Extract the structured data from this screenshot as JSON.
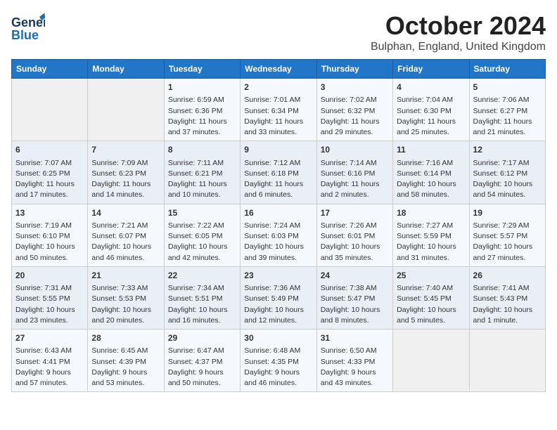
{
  "header": {
    "logo_general": "General",
    "logo_blue": "Blue",
    "month": "October 2024",
    "location": "Bulphan, England, United Kingdom"
  },
  "days_of_week": [
    "Sunday",
    "Monday",
    "Tuesday",
    "Wednesday",
    "Thursday",
    "Friday",
    "Saturday"
  ],
  "weeks": [
    [
      {
        "day": "",
        "data": ""
      },
      {
        "day": "",
        "data": ""
      },
      {
        "day": "1",
        "data": "Sunrise: 6:59 AM\nSunset: 6:36 PM\nDaylight: 11 hours and 37 minutes."
      },
      {
        "day": "2",
        "data": "Sunrise: 7:01 AM\nSunset: 6:34 PM\nDaylight: 11 hours and 33 minutes."
      },
      {
        "day": "3",
        "data": "Sunrise: 7:02 AM\nSunset: 6:32 PM\nDaylight: 11 hours and 29 minutes."
      },
      {
        "day": "4",
        "data": "Sunrise: 7:04 AM\nSunset: 6:30 PM\nDaylight: 11 hours and 25 minutes."
      },
      {
        "day": "5",
        "data": "Sunrise: 7:06 AM\nSunset: 6:27 PM\nDaylight: 11 hours and 21 minutes."
      }
    ],
    [
      {
        "day": "6",
        "data": "Sunrise: 7:07 AM\nSunset: 6:25 PM\nDaylight: 11 hours and 17 minutes."
      },
      {
        "day": "7",
        "data": "Sunrise: 7:09 AM\nSunset: 6:23 PM\nDaylight: 11 hours and 14 minutes."
      },
      {
        "day": "8",
        "data": "Sunrise: 7:11 AM\nSunset: 6:21 PM\nDaylight: 11 hours and 10 minutes."
      },
      {
        "day": "9",
        "data": "Sunrise: 7:12 AM\nSunset: 6:18 PM\nDaylight: 11 hours and 6 minutes."
      },
      {
        "day": "10",
        "data": "Sunrise: 7:14 AM\nSunset: 6:16 PM\nDaylight: 11 hours and 2 minutes."
      },
      {
        "day": "11",
        "data": "Sunrise: 7:16 AM\nSunset: 6:14 PM\nDaylight: 10 hours and 58 minutes."
      },
      {
        "day": "12",
        "data": "Sunrise: 7:17 AM\nSunset: 6:12 PM\nDaylight: 10 hours and 54 minutes."
      }
    ],
    [
      {
        "day": "13",
        "data": "Sunrise: 7:19 AM\nSunset: 6:10 PM\nDaylight: 10 hours and 50 minutes."
      },
      {
        "day": "14",
        "data": "Sunrise: 7:21 AM\nSunset: 6:07 PM\nDaylight: 10 hours and 46 minutes."
      },
      {
        "day": "15",
        "data": "Sunrise: 7:22 AM\nSunset: 6:05 PM\nDaylight: 10 hours and 42 minutes."
      },
      {
        "day": "16",
        "data": "Sunrise: 7:24 AM\nSunset: 6:03 PM\nDaylight: 10 hours and 39 minutes."
      },
      {
        "day": "17",
        "data": "Sunrise: 7:26 AM\nSunset: 6:01 PM\nDaylight: 10 hours and 35 minutes."
      },
      {
        "day": "18",
        "data": "Sunrise: 7:27 AM\nSunset: 5:59 PM\nDaylight: 10 hours and 31 minutes."
      },
      {
        "day": "19",
        "data": "Sunrise: 7:29 AM\nSunset: 5:57 PM\nDaylight: 10 hours and 27 minutes."
      }
    ],
    [
      {
        "day": "20",
        "data": "Sunrise: 7:31 AM\nSunset: 5:55 PM\nDaylight: 10 hours and 23 minutes."
      },
      {
        "day": "21",
        "data": "Sunrise: 7:33 AM\nSunset: 5:53 PM\nDaylight: 10 hours and 20 minutes."
      },
      {
        "day": "22",
        "data": "Sunrise: 7:34 AM\nSunset: 5:51 PM\nDaylight: 10 hours and 16 minutes."
      },
      {
        "day": "23",
        "data": "Sunrise: 7:36 AM\nSunset: 5:49 PM\nDaylight: 10 hours and 12 minutes."
      },
      {
        "day": "24",
        "data": "Sunrise: 7:38 AM\nSunset: 5:47 PM\nDaylight: 10 hours and 8 minutes."
      },
      {
        "day": "25",
        "data": "Sunrise: 7:40 AM\nSunset: 5:45 PM\nDaylight: 10 hours and 5 minutes."
      },
      {
        "day": "26",
        "data": "Sunrise: 7:41 AM\nSunset: 5:43 PM\nDaylight: 10 hours and 1 minute."
      }
    ],
    [
      {
        "day": "27",
        "data": "Sunrise: 6:43 AM\nSunset: 4:41 PM\nDaylight: 9 hours and 57 minutes."
      },
      {
        "day": "28",
        "data": "Sunrise: 6:45 AM\nSunset: 4:39 PM\nDaylight: 9 hours and 53 minutes."
      },
      {
        "day": "29",
        "data": "Sunrise: 6:47 AM\nSunset: 4:37 PM\nDaylight: 9 hours and 50 minutes."
      },
      {
        "day": "30",
        "data": "Sunrise: 6:48 AM\nSunset: 4:35 PM\nDaylight: 9 hours and 46 minutes."
      },
      {
        "day": "31",
        "data": "Sunrise: 6:50 AM\nSunset: 4:33 PM\nDaylight: 9 hours and 43 minutes."
      },
      {
        "day": "",
        "data": ""
      },
      {
        "day": "",
        "data": ""
      }
    ]
  ]
}
